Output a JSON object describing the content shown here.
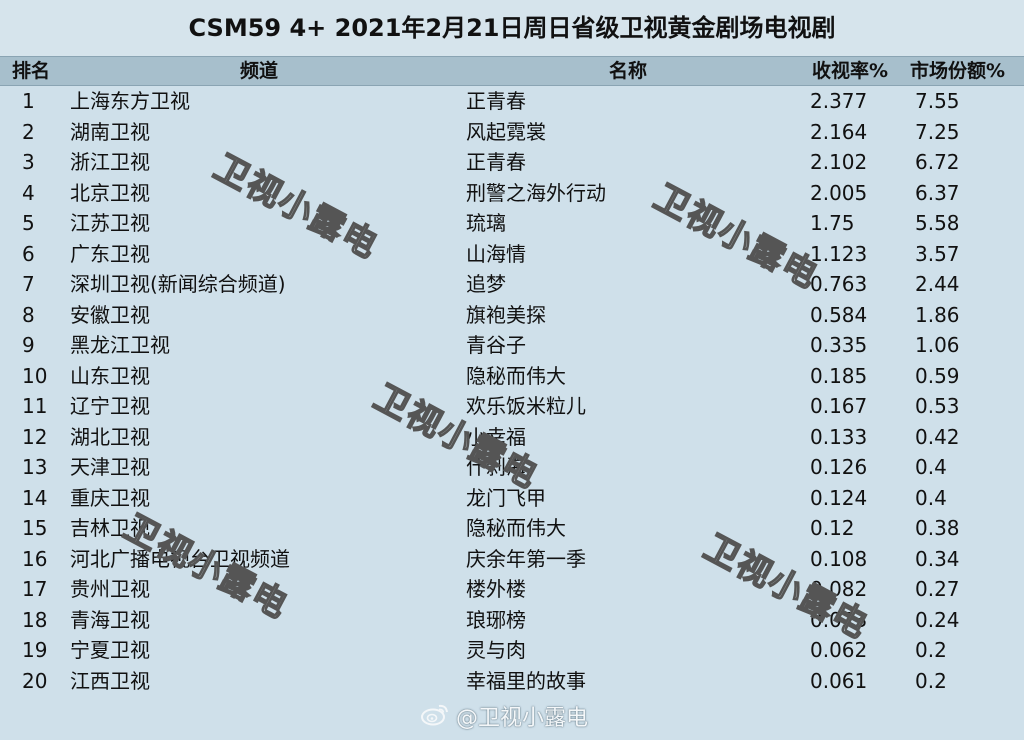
{
  "title": "CSM59 4+ 2021年2月21日周日省级卫视黄金剧场电视剧",
  "columns": {
    "rank": "排名",
    "channel": "频道",
    "drama": "名称",
    "rating": "收视率%",
    "share": "市场份额%"
  },
  "rows": [
    {
      "rank": "1",
      "channel": "上海东方卫视",
      "drama": "正青春",
      "rating": "2.377",
      "share": "7.55"
    },
    {
      "rank": "2",
      "channel": "湖南卫视",
      "drama": "风起霓裳",
      "rating": "2.164",
      "share": "7.25"
    },
    {
      "rank": "3",
      "channel": "浙江卫视",
      "drama": "正青春",
      "rating": "2.102",
      "share": "6.72"
    },
    {
      "rank": "4",
      "channel": "北京卫视",
      "drama": "刑警之海外行动",
      "rating": "2.005",
      "share": "6.37"
    },
    {
      "rank": "5",
      "channel": "江苏卫视",
      "drama": "琉璃",
      "rating": "1.75",
      "share": "5.58"
    },
    {
      "rank": "6",
      "channel": "广东卫视",
      "drama": "山海情",
      "rating": "1.123",
      "share": "3.57"
    },
    {
      "rank": "7",
      "channel": "深圳卫视(新闻综合频道)",
      "drama": "追梦",
      "rating": "0.763",
      "share": "2.44"
    },
    {
      "rank": "8",
      "channel": "安徽卫视",
      "drama": "旗袍美探",
      "rating": "0.584",
      "share": "1.86"
    },
    {
      "rank": "9",
      "channel": "黑龙江卫视",
      "drama": "青谷子",
      "rating": "0.335",
      "share": "1.06"
    },
    {
      "rank": "10",
      "channel": "山东卫视",
      "drama": "隐秘而伟大",
      "rating": "0.185",
      "share": "0.59"
    },
    {
      "rank": "11",
      "channel": "辽宁卫视",
      "drama": "欢乐饭米粒儿",
      "rating": "0.167",
      "share": "0.53"
    },
    {
      "rank": "12",
      "channel": "湖北卫视",
      "drama": "小幸福",
      "rating": "0.133",
      "share": "0.42"
    },
    {
      "rank": "13",
      "channel": "天津卫视",
      "drama": "什刹海",
      "rating": "0.126",
      "share": "0.4"
    },
    {
      "rank": "14",
      "channel": "重庆卫视",
      "drama": "龙门飞甲",
      "rating": "0.124",
      "share": "0.4"
    },
    {
      "rank": "15",
      "channel": "吉林卫视",
      "drama": "隐秘而伟大",
      "rating": "0.12",
      "share": "0.38"
    },
    {
      "rank": "16",
      "channel": "河北广播电视台卫视频道",
      "drama": "庆余年第一季",
      "rating": "0.108",
      "share": "0.34"
    },
    {
      "rank": "17",
      "channel": "贵州卫视",
      "drama": "楼外楼",
      "rating": "0.082",
      "share": "0.27"
    },
    {
      "rank": "18",
      "channel": "青海卫视",
      "drama": "琅琊榜",
      "rating": "0.073",
      "share": "0.24"
    },
    {
      "rank": "19",
      "channel": "宁夏卫视",
      "drama": "灵与肉",
      "rating": "0.062",
      "share": "0.2"
    },
    {
      "rank": "20",
      "channel": "江西卫视",
      "drama": "幸福里的故事",
      "rating": "0.061",
      "share": "0.2"
    }
  ],
  "watermark_text": "卫视小露电",
  "footer_watermark": "@卫视小露电",
  "icons": {
    "footer": "weibo-icon"
  },
  "colors": {
    "background": "#cfe0ea",
    "header": "#a7bfcc"
  }
}
